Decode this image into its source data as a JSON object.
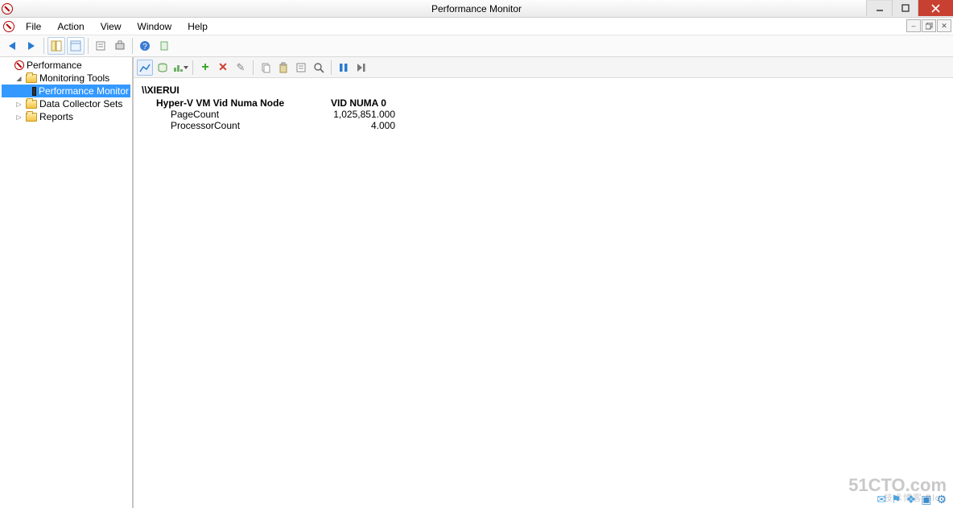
{
  "window": {
    "title": "Performance Monitor"
  },
  "menu": {
    "file": "File",
    "action": "Action",
    "view": "View",
    "window": "Window",
    "help": "Help"
  },
  "tree": {
    "root": "Performance",
    "monitoring_tools": "Monitoring Tools",
    "performance_monitor": "Performance Monitor",
    "data_collector_sets": "Data Collector Sets",
    "reports": "Reports"
  },
  "report": {
    "host": "\\\\XIERUI",
    "category": "Hyper-V VM Vid Numa Node",
    "instance": "VID NUMA 0",
    "counters": [
      {
        "name": "PageCount",
        "value": "1,025,851.000"
      },
      {
        "name": "ProcessorCount",
        "value": "4.000"
      }
    ]
  },
  "icons": {
    "back": "back-arrow",
    "forward": "forward-arrow",
    "add": "plus",
    "delete": "x",
    "highlight": "pencil",
    "copy": "copy",
    "paste": "paste",
    "properties": "properties",
    "zoom": "zoom",
    "freeze": "pause",
    "update": "step"
  },
  "watermark": {
    "main": "51CTO.com",
    "sub": "技术博客  Blog"
  }
}
